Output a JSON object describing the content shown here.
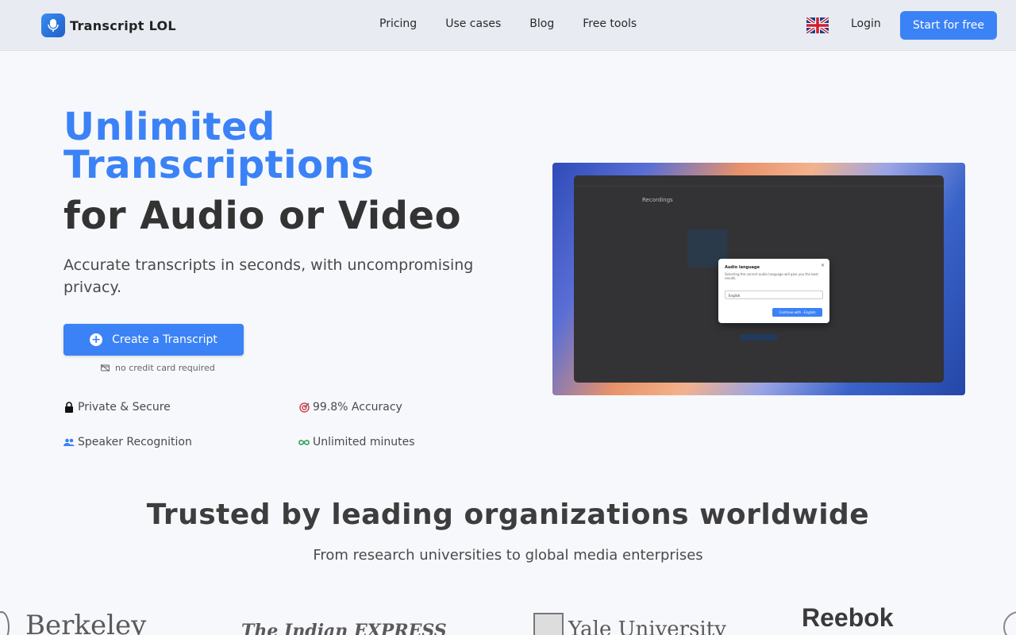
{
  "header": {
    "brand": "Transcript LOL",
    "nav": [
      "Pricing",
      "Use cases",
      "Blog",
      "Free tools"
    ],
    "login": "Login",
    "start": "Start for free"
  },
  "hero": {
    "title_line1": "Unlimited",
    "title_line2": "Transcriptions",
    "title_line3": "for Audio or Video",
    "subtitle": "Accurate transcripts in seconds, with uncompromising privacy.",
    "cta": "Create a Transcript",
    "no_credit": "no credit card required",
    "features": [
      "Private & Secure",
      "99.8% Accuracy",
      "Speaker Recognition",
      "Unlimited minutes"
    ]
  },
  "preview": {
    "window_title": "Recordings",
    "modal_title": "Audio language",
    "modal_desc": "Selecting the correct audio language will give you the best results.",
    "select_value": "English",
    "button": "Continue with · English"
  },
  "trusted": {
    "title": "Trusted by leading organizations worldwide",
    "subtitle": "From research universities to global media enterprises",
    "logos": [
      "Berkeley",
      "The Indian EXPRESS",
      "Yale University",
      "Reebok"
    ]
  },
  "colors": {
    "accent": "#3b82f6",
    "header_bg": "#e8ebf2",
    "page_bg": "#f7f8fc"
  }
}
